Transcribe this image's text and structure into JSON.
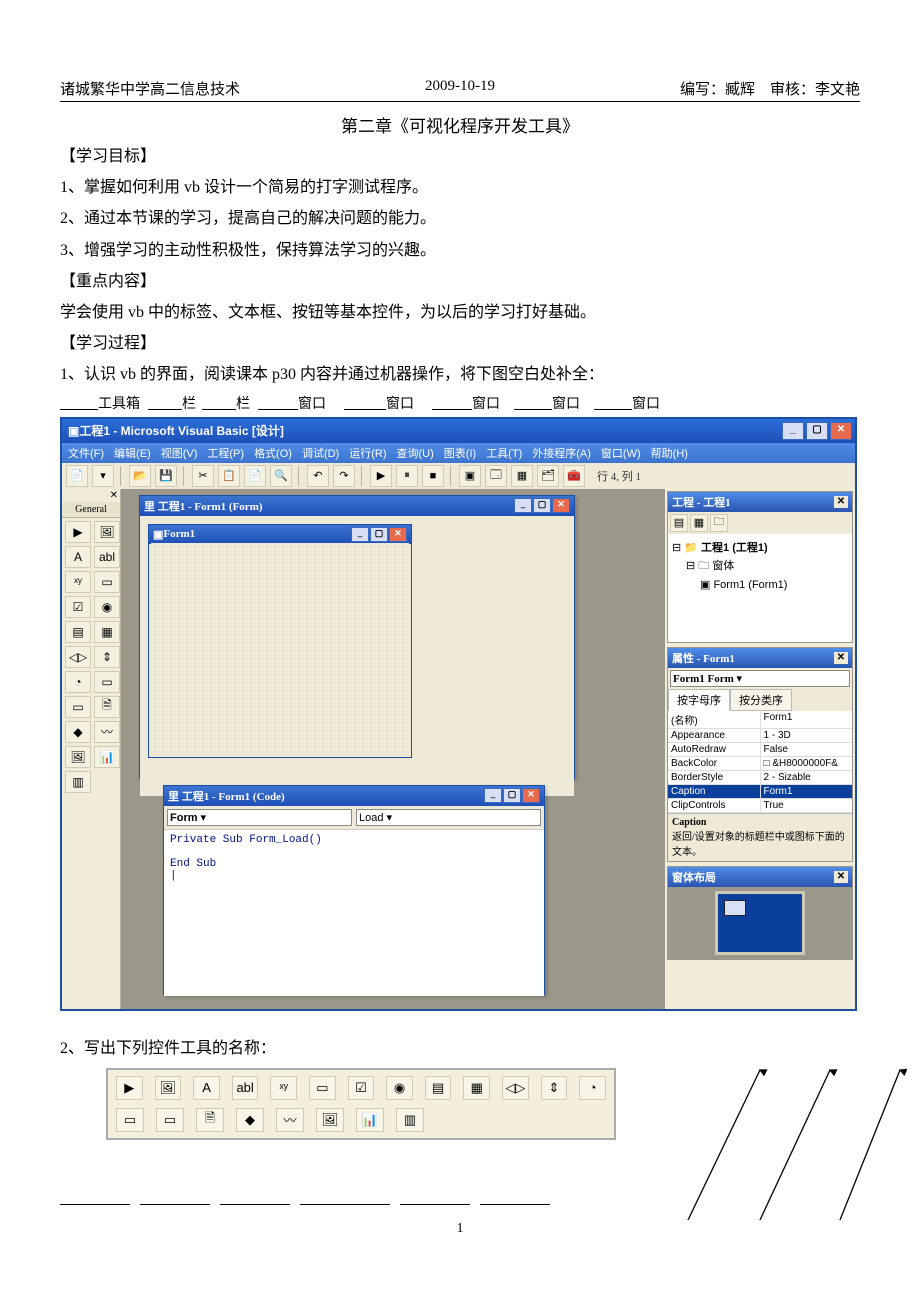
{
  "header": {
    "left": "诸城繁华中学高二信息技术",
    "center": "2009-10-19",
    "right": "编写：臧辉　审核：李文艳"
  },
  "title": "第二章《可视化程序开发工具》",
  "section_labels": {
    "goals": "【学习目标】",
    "key": "【重点内容】",
    "process": "【学习过程】"
  },
  "goals": [
    "1、掌握如何利用 vb 设计一个简易的打字测试程序。",
    "2、通过本节课的学习，提高自己的解决问题的能力。",
    "3、增强学习的主动性积极性，保持算法学习的兴趣。"
  ],
  "key_content": "学会使用 vb 中的标签、文本框、按钮等基本控件，为以后的学习打好基础。",
  "process1": "1、认识 vb 的界面，阅读课本 p30 内容并通过机器操作，将下图空白处补全：",
  "blank_labels": [
    "工具箱",
    "栏",
    "栏",
    "窗口",
    "窗口",
    "窗口",
    "窗口",
    "窗口"
  ],
  "vb": {
    "title": "工程1 - Microsoft Visual Basic [设计]",
    "menu": [
      "文件(F)",
      "编辑(E)",
      "视图(V)",
      "工程(P)",
      "格式(O)",
      "调试(D)",
      "运行(R)",
      "查询(U)",
      "图表(I)",
      "工具(T)",
      "外接程序(A)",
      "窗口(W)",
      "帮助(H)"
    ],
    "toolbar_status": "行 4, 列 1",
    "toolbox_title": "General",
    "toolbox_icons": [
      "▶",
      "🖼",
      "A",
      "abl",
      "ˣʸ",
      "▭",
      "☑",
      "◉",
      "▤",
      "▦",
      "◁▷",
      "⇕",
      "◔",
      "▭",
      "▭",
      "🗎",
      "◆",
      "〰",
      "🖼",
      "📊",
      "▥"
    ],
    "form_designer_title": "里 工程1 - Form1 (Form)",
    "form_caption": "Form1",
    "code_title": "里 工程1 - Form1 (Code)",
    "code_object": "Form",
    "code_event": "Load",
    "code_text": "Private Sub Form_Load()\n\nEnd Sub\n|",
    "project_panel_title": "工程 - 工程1",
    "project_tree": {
      "root": "工程1 (工程1)",
      "folder": "窗体",
      "form": "Form1 (Form1)"
    },
    "props_panel_title": "属性 - Form1",
    "props_object": "Form1 Form",
    "props_tabs": [
      "按字母序",
      "按分类序"
    ],
    "props_rows": [
      [
        "(名称)",
        "Form1"
      ],
      [
        "Appearance",
        "1 - 3D"
      ],
      [
        "AutoRedraw",
        "False"
      ],
      [
        "BackColor",
        "□ &H8000000F&"
      ],
      [
        "BorderStyle",
        "2 - Sizable"
      ],
      [
        "Caption",
        "Form1"
      ],
      [
        "ClipControls",
        "True"
      ]
    ],
    "props_desc_title": "Caption",
    "props_desc_text": "返回/设置对象的标题栏中或图标下面的文本。",
    "layout_title": "窗体布局",
    "win_btns": {
      "min": "_",
      "max": "▢",
      "close": "✕"
    }
  },
  "q2_text": "2、写出下列控件工具的名称：",
  "q2_row1": [
    "▶",
    "🖼",
    "A",
    "abl",
    "ˣʸ",
    "▭",
    "☑",
    "◉",
    "▤",
    "▦",
    "◁▷",
    "⇕",
    "◔"
  ],
  "q2_row2": [
    "▭",
    "▭",
    "🗎",
    "◆",
    "〰",
    "🖼",
    "📊",
    "▥"
  ],
  "page_number": "1"
}
